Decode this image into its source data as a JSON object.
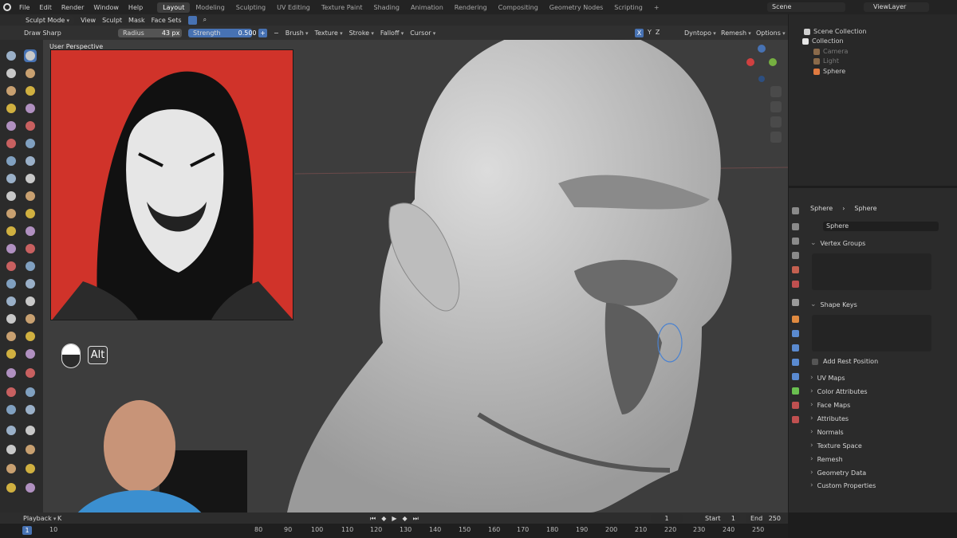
{
  "top_menu": [
    "File",
    "Edit",
    "Render",
    "Window",
    "Help"
  ],
  "workspaces": [
    "Layout",
    "Modeling",
    "Sculpting",
    "UV Editing",
    "Texture Paint",
    "Shading",
    "Animation",
    "Rendering",
    "Compositing",
    "Geometry Nodes",
    "Scripting"
  ],
  "active_workspace": "Layout",
  "scene_name": "Scene",
  "view_layer": "ViewLayer",
  "header": {
    "mode": "Sculpt Mode",
    "menus": [
      "View",
      "Sculpt",
      "Mask",
      "Face Sets"
    ]
  },
  "tool_settings": {
    "brush_name": "Draw Sharp",
    "radius_label": "Radius",
    "radius_value": "43 px",
    "strength_label": "Strength",
    "strength_value": "0.500",
    "plus": "+",
    "minus": "−",
    "menus": [
      "Brush",
      "Texture",
      "Stroke",
      "Falloff",
      "Cursor"
    ],
    "axes": [
      "X",
      "Y",
      "Z"
    ],
    "dyntopo": "Dyntopo",
    "remesh": "Remesh",
    "options": "Options"
  },
  "viewport": {
    "title": "User Perspective",
    "alt_key": "Alt"
  },
  "outliner": {
    "scene_collection": "Scene Collection",
    "collection": "Collection",
    "items": [
      "Camera",
      "Light",
      "Sphere"
    ]
  },
  "properties": {
    "breadcrumb_object": "Sphere",
    "breadcrumb_data": "Sphere",
    "data_name": "Sphere",
    "vertex_groups": "Vertex Groups",
    "shape_keys": "Shape Keys",
    "add_rest_position": "Add Rest Position",
    "panels": [
      "UV Maps",
      "Color Attributes",
      "Face Maps",
      "Attributes",
      "Normals",
      "Texture Space",
      "Remesh",
      "Geometry Data",
      "Custom Properties"
    ]
  },
  "timeline": {
    "playback": "Playback",
    "keying": "K",
    "current_frame": "1",
    "start_label": "Start",
    "start": "1",
    "end_label": "End",
    "end": "250",
    "cursor_frame": "1",
    "ticks": [
      "10",
      "80",
      "90",
      "100",
      "110",
      "120",
      "130",
      "140",
      "150",
      "160",
      "170",
      "180",
      "190",
      "200",
      "210",
      "220",
      "230",
      "240",
      "250"
    ]
  },
  "colors": {
    "accent": "#4772b3",
    "ref_bg": "#d0332a",
    "mesh": "#c9c9c9",
    "viewport_bg": "#3d3d3d"
  }
}
